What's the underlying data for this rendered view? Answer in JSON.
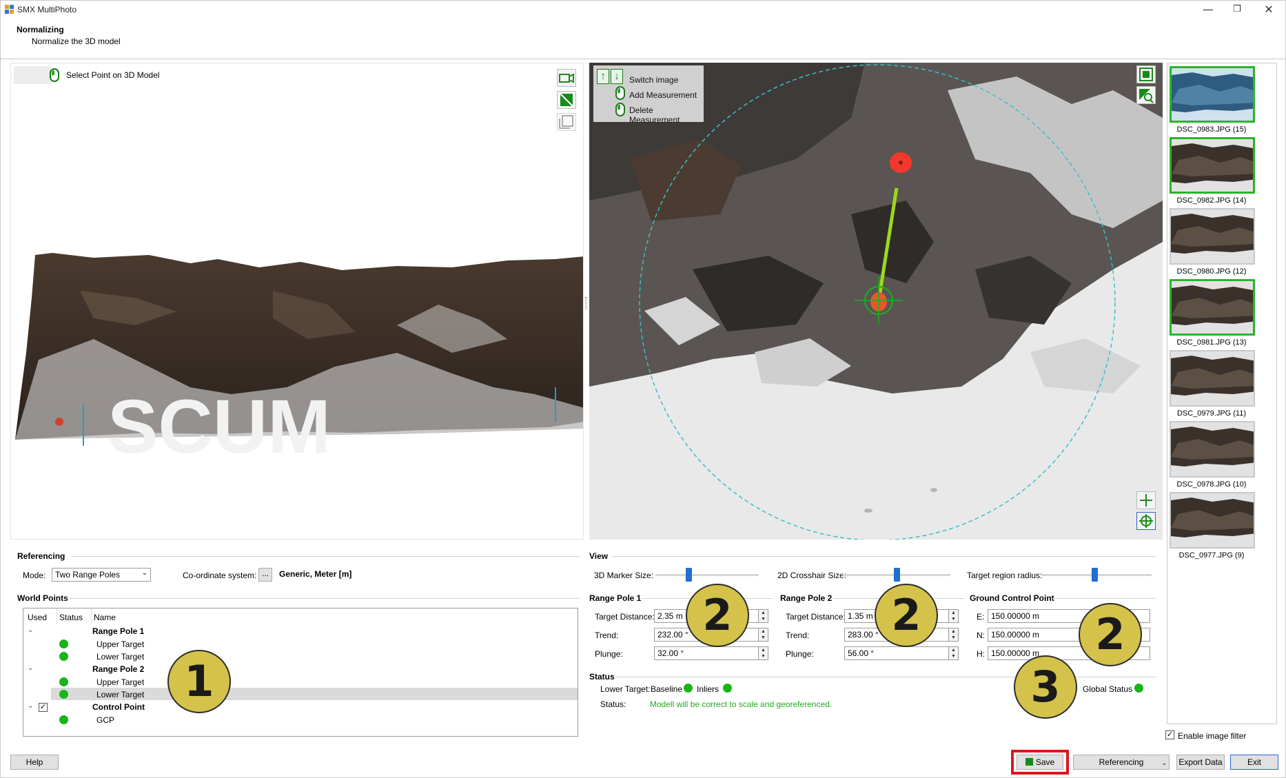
{
  "window": {
    "title": "SMX MultiPhoto",
    "controls": {
      "minimize": "—",
      "restore": "❐",
      "close": "✕"
    }
  },
  "header": {
    "title": "Normalizing",
    "subtitle": "Normalize the 3D model"
  },
  "view3d": {
    "select_point_label": "Select Point on 3D Model",
    "tools": [
      "camera-icon",
      "texture-toggle-icon",
      "frame-icon"
    ]
  },
  "photo_view": {
    "controls": {
      "switch_image": "Switch image",
      "add_measurement": "Add Measurement",
      "delete_measurement": "Delete Measurement"
    },
    "tools": [
      "fit-view-icon",
      "zoom-region-icon",
      "add-point-icon",
      "center-target-icon"
    ]
  },
  "thumbnails": [
    {
      "caption": "DSC_0983.JPG (15)",
      "selected": true,
      "active": true
    },
    {
      "caption": "DSC_0982.JPG (14)",
      "selected": true,
      "active": false
    },
    {
      "caption": "DSC_0980.JPG (12)",
      "selected": false,
      "active": false
    },
    {
      "caption": "DSC_0981.JPG (13)",
      "selected": true,
      "active": false
    },
    {
      "caption": "DSC_0979.JPG (11)",
      "selected": false,
      "active": false
    },
    {
      "caption": "DSC_0978.JPG (10)",
      "selected": false,
      "active": false
    },
    {
      "caption": "DSC_0977.JPG (9)",
      "selected": false,
      "active": false
    }
  ],
  "enable_filter": {
    "label": "Enable image filter",
    "checked": true
  },
  "referencing": {
    "title": "Referencing",
    "mode_label": "Mode:",
    "mode_value": "Two Range Poles",
    "coord_label": "Co-ordinate system:",
    "coord_btn": "...",
    "coord_value": "Generic, Meter [m]"
  },
  "world_points": {
    "title": "World Points",
    "headers": {
      "used": "Used",
      "status": "Status",
      "name": "Name"
    },
    "rows": [
      {
        "name": "Range Pole 1",
        "group": true
      },
      {
        "name": "Upper Target",
        "group": false
      },
      {
        "name": "Lower Target",
        "group": false
      },
      {
        "name": "Range Pole 2",
        "group": true
      },
      {
        "name": "Upper Target",
        "group": false
      },
      {
        "name": "Lower Target",
        "group": false,
        "highlighted": true
      },
      {
        "name": "Control Point",
        "group": true
      },
      {
        "name": "GCP",
        "group": false
      }
    ]
  },
  "view_settings": {
    "title": "View",
    "marker_size_label": "3D Marker Size:",
    "crosshair_size_label": "2D Crosshair Size:",
    "region_radius_label": "Target region radius:",
    "marker_size_level": 0.32,
    "crosshair_size_level": 0.5,
    "region_radius_level": 0.48
  },
  "range_pole1": {
    "title": "Range Pole 1",
    "target_distance_label": "Target Distance:",
    "target_distance": "2.35 m",
    "trend_label": "Trend:",
    "trend": "232.00 °",
    "plunge_label": "Plunge:",
    "plunge": "32.00 °"
  },
  "range_pole2": {
    "title": "Range Pole 2",
    "target_distance_label": "Target Distance:",
    "target_distance": "1.35 m",
    "trend_label": "Trend:",
    "trend": "283.00 °",
    "plunge_label": "Plunge:",
    "plunge": "56.00 °"
  },
  "gcp": {
    "title": "Ground Control Point",
    "e_label": "E:",
    "e": "150.00000 m",
    "n_label": "N:",
    "n": "150.00000 m",
    "h_label": "H:",
    "h": "150.00000 m"
  },
  "status": {
    "title": "Status",
    "lower_target_label": "Lower Target:",
    "baseline_label": "Baseline",
    "inliers_label": "Inliers",
    "global_label": "Global Status",
    "status_label": "Status:",
    "status_text": "Modell will be correct to scale and georeferenced."
  },
  "badges": [
    "1",
    "2",
    "2",
    "2",
    "3"
  ],
  "footer": {
    "help": "Help",
    "save": "Save",
    "referencing": "Referencing",
    "export": "Export Data",
    "exit": "Exit"
  },
  "colors": {
    "accent_green": "#18b418",
    "highlight_red": "#e0141e",
    "badge_gold": "#d4c24a",
    "primary_blue": "#1f6fd0"
  }
}
